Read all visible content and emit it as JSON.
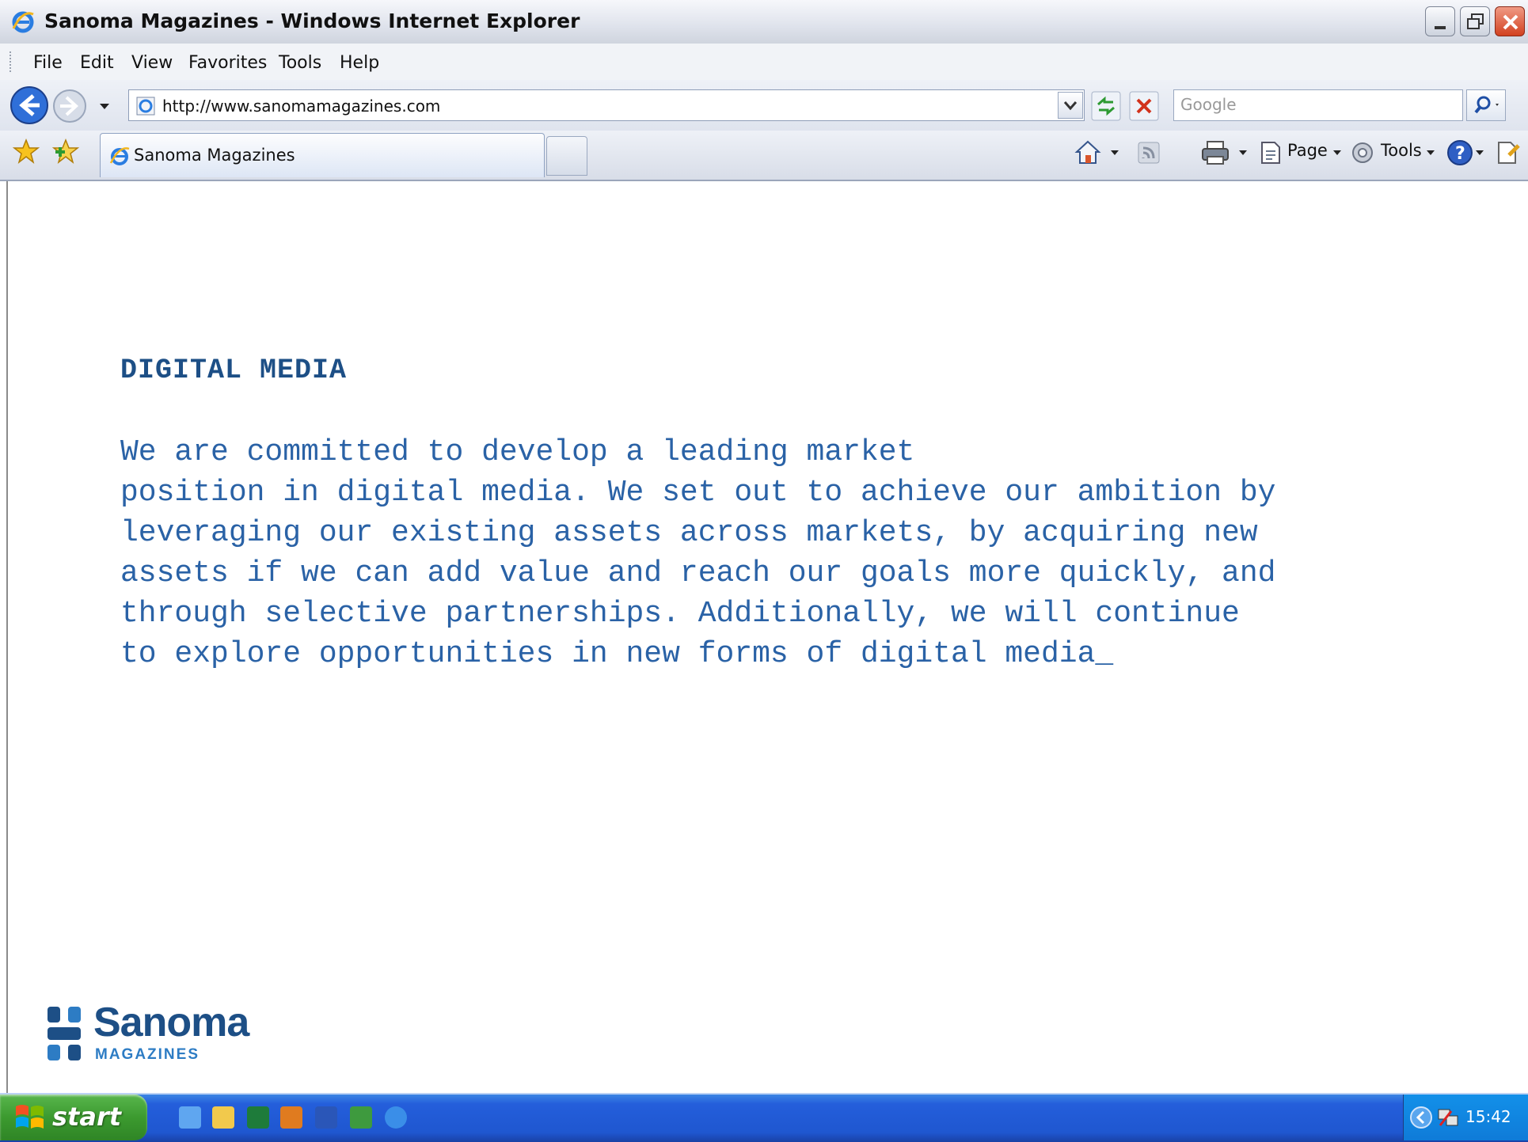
{
  "window": {
    "title": "Sanoma Magazines - Windows Internet Explorer"
  },
  "menu": {
    "items": [
      "File",
      "Edit",
      "View",
      "Favorites",
      "Tools",
      "Help"
    ]
  },
  "address_bar": {
    "url": "http://www.sanomamagazines.com"
  },
  "search": {
    "placeholder": "Google"
  },
  "tabs": [
    {
      "label": "Sanoma Magazines"
    }
  ],
  "command_bar": {
    "page_label": "Page",
    "tools_label": "Tools"
  },
  "page": {
    "heading": "DIGITAL MEDIA",
    "paragraph_lines": [
      "We are committed to develop a leading market",
      "position in digital media. We set out to achieve our ambition by",
      "leveraging our existing assets across markets, by acquiring new",
      "assets if we can add value and reach our goals more quickly, and",
      "through selective partnerships. Additionally, we will continue",
      "to explore opportunities in new forms of digital media_"
    ],
    "logo": {
      "name": "Sanoma",
      "sub": "MAGAZINES"
    }
  },
  "taskbar": {
    "start_label": "start",
    "clock": "15:42"
  },
  "colors": {
    "heading": "#1d4f86",
    "body_text": "#2a62a6",
    "taskbar": "#245edb",
    "start_button": "#3c9a2f"
  }
}
